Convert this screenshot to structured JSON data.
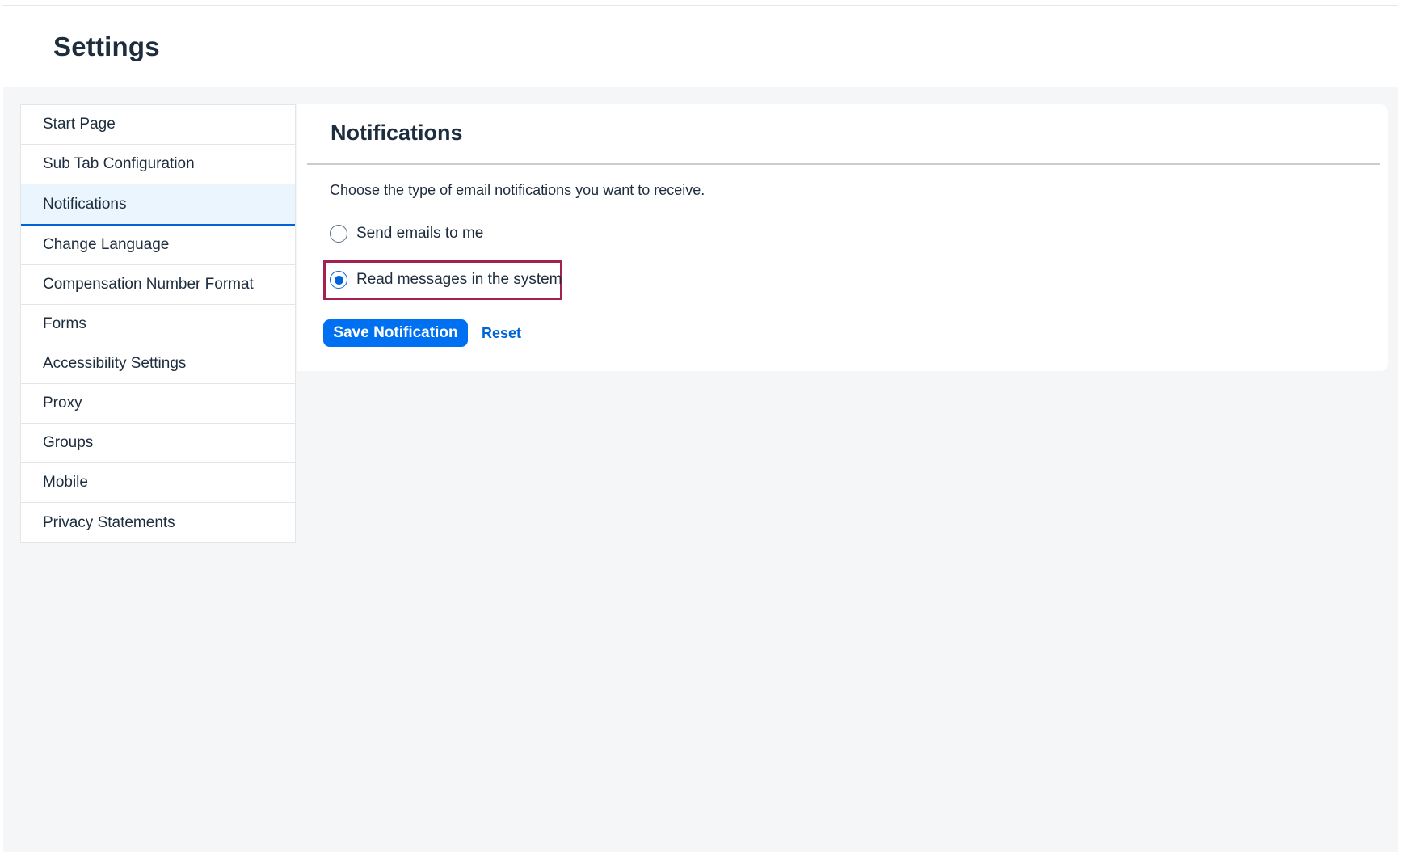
{
  "header": {
    "title": "Settings"
  },
  "sidebar": {
    "items": [
      {
        "label": "Start Page"
      },
      {
        "label": "Sub Tab Configuration"
      },
      {
        "label": "Notifications",
        "selected": true
      },
      {
        "label": "Change Language"
      },
      {
        "label": "Compensation Number Format"
      },
      {
        "label": "Forms"
      },
      {
        "label": "Accessibility Settings"
      },
      {
        "label": "Proxy"
      },
      {
        "label": "Groups"
      },
      {
        "label": "Mobile"
      },
      {
        "label": "Privacy Statements"
      }
    ]
  },
  "panel": {
    "title": "Notifications",
    "description": "Choose the type of email notifications you want to receive.",
    "options": [
      {
        "label": "Send emails to me",
        "checked": false
      },
      {
        "label": "Read messages in the system",
        "checked": true,
        "highlighted": true
      }
    ],
    "save_label": "Save Notification",
    "reset_label": "Reset"
  },
  "colors": {
    "accent": "#0070f2",
    "link": "#0064d9",
    "highlight_border": "#a3214f",
    "selected_bg": "#eaf5fd"
  }
}
